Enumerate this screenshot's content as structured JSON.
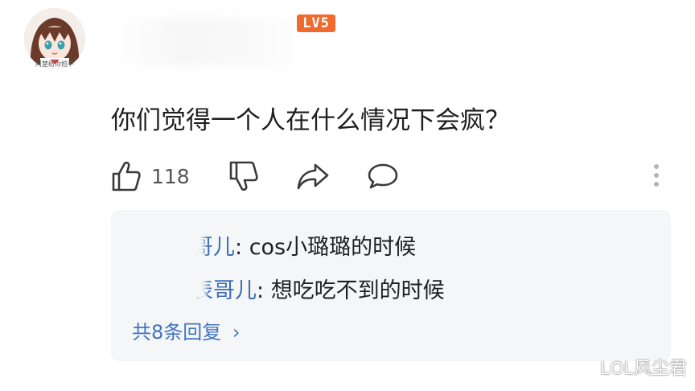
{
  "post": {
    "avatar_caption": "阿楚给你拍平",
    "level_badge": "LV5",
    "comment_text": "你们觉得一个人在什么情况下会疯？",
    "like_count": "118"
  },
  "icons": {
    "like": "thumbs-up-icon",
    "dislike": "thumbs-down-icon",
    "share": "share-icon",
    "comment": "comment-icon",
    "more": "more-vertical-icon"
  },
  "replies": {
    "items": [
      {
        "name": "哥儿",
        "separator": ": ",
        "text": "cos小璐璐的时候"
      },
      {
        "name": "表哥儿",
        "separator": ": ",
        "text": "想吃吃不到的时候"
      }
    ],
    "view_more_label": "共8条回复",
    "view_more_chevron": "›"
  },
  "watermark": "LOL风尘君",
  "colors": {
    "level_badge": "#f06a2e",
    "reply_name": "#3d6fb4",
    "link": "#3f74c3",
    "reply_panel": "#f5f6f8"
  }
}
